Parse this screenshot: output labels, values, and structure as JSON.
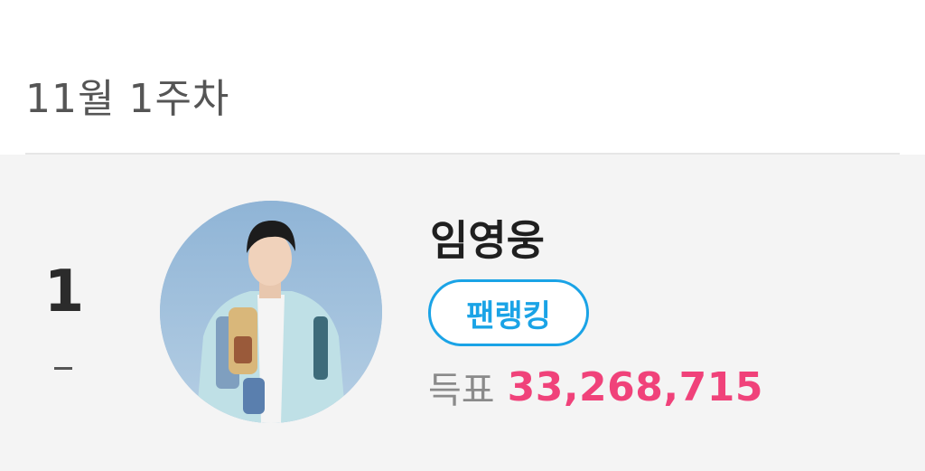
{
  "header": {
    "week_title": "11월 1주차"
  },
  "ranking": [
    {
      "rank": "1",
      "rank_change": "-",
      "artist_name": "임영웅",
      "badge_label": "팬랭킹",
      "vote_label": "득표",
      "vote_count": "33,268,715"
    }
  ],
  "colors": {
    "badge_accent": "#1aa3e6",
    "vote_count": "#f0427a",
    "card_background": "#f4f4f4"
  },
  "icons": {
    "avatar": "artist-photo"
  }
}
